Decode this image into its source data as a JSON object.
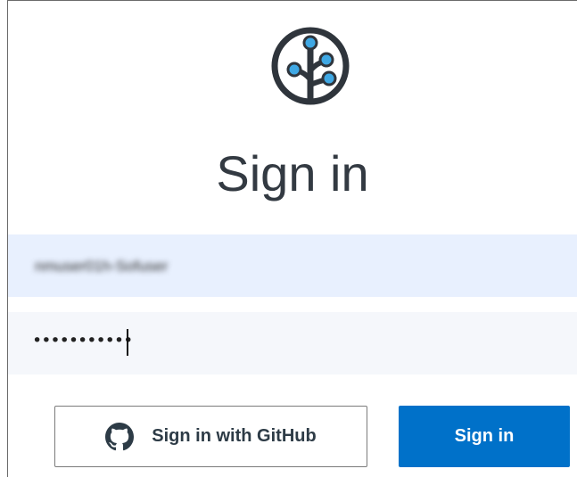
{
  "page": {
    "title": "Sign in"
  },
  "logo": {
    "icon": "tree-logo-icon"
  },
  "username": {
    "value": "nmuser01h-Sofuser",
    "obscured": true
  },
  "password": {
    "value": "•••••••••••"
  },
  "buttons": {
    "github_label": "Sign in with GitHub",
    "github_icon": "github-icon",
    "signin_label": "Sign in"
  },
  "colors": {
    "primary": "#0071c9",
    "username_bg": "#e8f0fe",
    "password_bg": "#f5f7fb",
    "logo_dot": "#3fa8e4",
    "text_dark": "#333a42"
  }
}
